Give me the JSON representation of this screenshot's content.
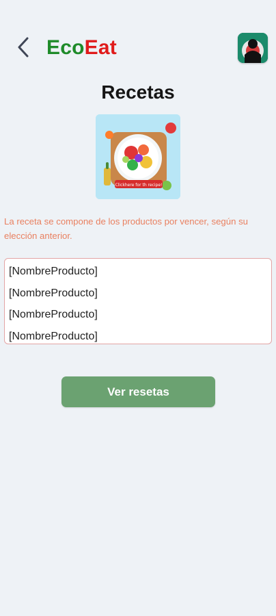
{
  "header": {
    "back_icon": "chevron-left-icon",
    "logo": {
      "part1": "Eco",
      "part2": "Eat"
    },
    "avatar_icon": "user-avatar-icon"
  },
  "page": {
    "title": "Recetas",
    "image_caption": "Clickhere for th recipe!",
    "description": "La receta se compone de los productos por vencer, según su  elección anterior."
  },
  "products": [
    "[NombreProducto]",
    "[NombreProducto]",
    "[NombreProducto]",
    "[NombreProducto]"
  ],
  "actions": {
    "primary_label": "Ver resetas"
  },
  "colors": {
    "background": "#eef2f6",
    "eco": "#1f8b2a",
    "eat": "#e01b1b",
    "description": "#e98060",
    "button": "#6ba271",
    "list_border": "#e2a4a4"
  }
}
